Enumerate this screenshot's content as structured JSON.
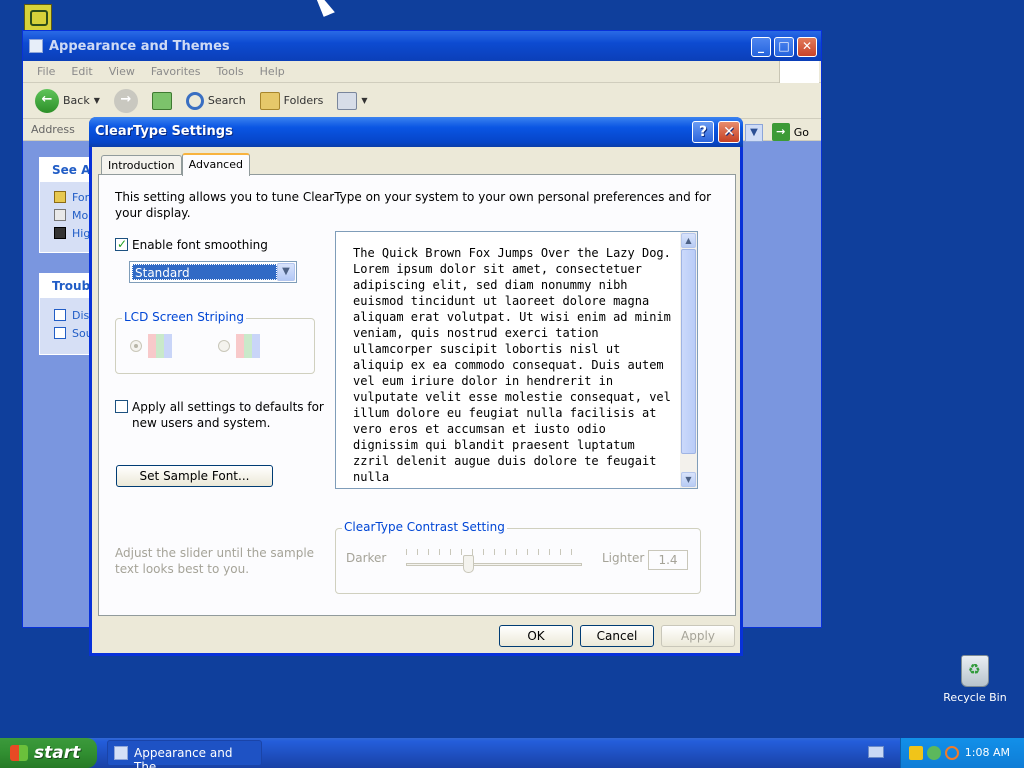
{
  "explorer": {
    "title": "Appearance and Themes",
    "menu": [
      "File",
      "Edit",
      "View",
      "Favorites",
      "Tools",
      "Help"
    ],
    "toolbar": {
      "back": "Back",
      "search": "Search",
      "folders": "Folders"
    },
    "address_label": "Address",
    "go_label": "Go",
    "see_also": {
      "title": "See Als",
      "items": [
        "For",
        "Mo",
        "Hig"
      ]
    },
    "troubleshooters": {
      "title": "Troubl",
      "items": [
        "Dis",
        "Sou"
      ]
    }
  },
  "dialog": {
    "title": "ClearType Settings",
    "help_glyph": "?",
    "close_glyph": "✕",
    "tabs": [
      "Introduction",
      "Advanced"
    ],
    "active_tab": 1,
    "description": "This setting allows you to tune ClearType on your system to your own personal preferences and for your display.",
    "enable_smoothing": {
      "label": "Enable font smoothing",
      "checked": true
    },
    "smoothing_select": {
      "value": "Standard"
    },
    "lcd_group": {
      "title": "LCD Screen Striping"
    },
    "apply_defaults": {
      "label": "Apply all settings to defaults for new users and system.",
      "checked": false
    },
    "sample_font_button": "Set Sample Font...",
    "sample_text": "The Quick Brown Fox Jumps Over the Lazy Dog. Lorem ipsum dolor sit amet, consectetuer adipiscing elit, sed diam nonummy nibh euismod tincidunt ut laoreet dolore magna aliquam erat volutpat. Ut wisi enim ad minim veniam, quis nostrud exerci tation ullamcorper suscipit lobortis nisl ut aliquip ex ea commodo consequat. Duis autem vel eum iriure dolor in hendrerit in vulputate velit esse molestie consequat, vel illum dolore eu feugiat nulla facilisis at vero eros et accumsan et iusto odio dignissim qui blandit praesent luptatum zzril delenit augue duis dolore te feugait nulla",
    "hint": "Adjust the slider until the sample text looks best to you.",
    "contrast": {
      "title": "ClearType Contrast Setting",
      "darker": "Darker",
      "lighter": "Lighter",
      "value": "1.4"
    },
    "buttons": {
      "ok": "OK",
      "cancel": "Cancel",
      "apply": "Apply"
    }
  },
  "desktop": {
    "recycle_bin": "Recycle Bin"
  },
  "taskbar": {
    "start": "start",
    "task": "Appearance and The...",
    "clock": "1:08 AM"
  }
}
